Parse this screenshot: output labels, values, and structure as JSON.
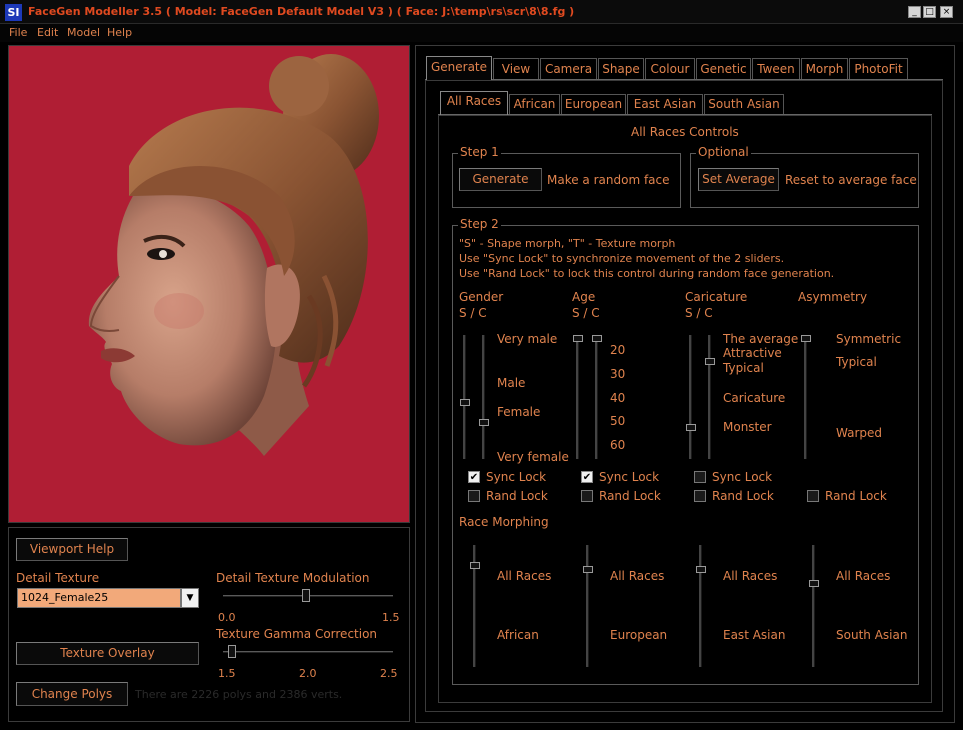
{
  "window": {
    "title": "FaceGen Modeller 3.5  ( Model: FaceGen Default Model V3 )  ( Face: J:\\temp\\rs\\scr\\8\\8.fg )",
    "logo": "SI",
    "min": "_",
    "max": "□",
    "close": "×"
  },
  "menu": [
    "File",
    "Edit",
    "Model",
    "Help"
  ],
  "left": {
    "viewport_help": "Viewport Help",
    "detail_texture_label": "Detail Texture",
    "detail_texture_value": "1024_Female25",
    "modulation_label": "Detail Texture Modulation",
    "modulation_ticks": [
      "0.0",
      "1.5"
    ],
    "modulation_value": 0.49,
    "gamma_label": "Texture Gamma Correction",
    "gamma_ticks": [
      "1.5",
      "2.0",
      "2.5"
    ],
    "gamma_value": 0.03,
    "texture_overlay": "Texture Overlay",
    "change_polys": "Change Polys",
    "poly_info": "There are 2226 polys and 2386 verts."
  },
  "tabs": [
    "Generate",
    "View",
    "Camera",
    "Shape",
    "Colour",
    "Genetic",
    "Tween",
    "Morph",
    "PhotoFit"
  ],
  "subtabs": [
    "All Races",
    "African",
    "European",
    "East Asian",
    "South Asian"
  ],
  "controls_title": "All Races Controls",
  "step1": {
    "label": "Step 1",
    "button": "Generate",
    "desc": "Make a random face"
  },
  "optional": {
    "label": "Optional",
    "button": "Set Average",
    "desc": "Reset to average face"
  },
  "step2": {
    "label": "Step 2",
    "help": [
      "\"S\" - Shape morph, \"T\" - Texture morph",
      "Use \"Sync Lock\" to synchronize movement of the 2 sliders.",
      "Use \"Rand Lock\" to lock this control during random face generation."
    ],
    "gender": {
      "title": "Gender",
      "sc": "S / C",
      "labels": [
        "Very male",
        "Male",
        "Female",
        "Very female"
      ],
      "sync": "Sync Lock",
      "rand": "Rand Lock",
      "sync_checked": true,
      "values": [
        0.55,
        0.72
      ]
    },
    "age": {
      "title": "Age",
      "sc": "S / C",
      "labels": [
        "20",
        "30",
        "40",
        "50",
        "60"
      ],
      "sync": "Sync Lock",
      "rand": "Rand Lock",
      "sync_checked": true,
      "values": [
        0.0,
        0.0
      ]
    },
    "caricature": {
      "title": "Caricature",
      "sc": "S / C",
      "labels": [
        "The average",
        "Attractive",
        "Typical",
        "Caricature",
        "Monster"
      ],
      "sync": "Sync Lock",
      "rand": "Rand Lock",
      "sync_checked": false,
      "values": [
        0.76,
        0.2
      ]
    },
    "asymmetry": {
      "title": "Asymmetry",
      "labels": [
        "Symmetric",
        "Typical",
        "Warped"
      ],
      "rand": "Rand Lock",
      "values": [
        0.0
      ]
    }
  },
  "race_morphing": {
    "title": "Race Morphing",
    "sliders": [
      {
        "top": "All Races",
        "bottom": "African",
        "value": 0.15
      },
      {
        "top": "All Races",
        "bottom": "European",
        "value": 0.18
      },
      {
        "top": "All Races",
        "bottom": "East Asian",
        "value": 0.18
      },
      {
        "top": "All Races",
        "bottom": "South Asian",
        "value": 0.3
      }
    ]
  },
  "colors": {
    "accent": "#e0834e",
    "viewport_bg": "#b01e34",
    "title_text": "#e04a20"
  }
}
